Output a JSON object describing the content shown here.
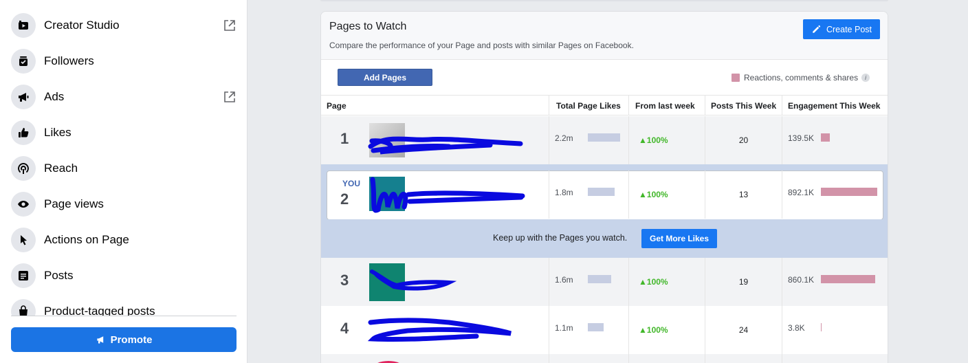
{
  "sidebar": {
    "items": [
      {
        "label": "Creator Studio",
        "icon": "creator-studio-icon",
        "external": true
      },
      {
        "label": "Followers",
        "icon": "followers-icon",
        "external": false
      },
      {
        "label": "Ads",
        "icon": "megaphone-icon",
        "external": true
      },
      {
        "label": "Likes",
        "icon": "thumbs-up-icon",
        "external": false
      },
      {
        "label": "Reach",
        "icon": "reach-icon",
        "external": false
      },
      {
        "label": "Page views",
        "icon": "eye-icon",
        "external": false
      },
      {
        "label": "Actions on Page",
        "icon": "cursor-icon",
        "external": false
      },
      {
        "label": "Posts",
        "icon": "posts-icon",
        "external": false
      },
      {
        "label": "Product-tagged posts",
        "icon": "shopping-bag-icon",
        "external": false
      }
    ],
    "promote_label": "Promote"
  },
  "panel": {
    "title": "Pages to Watch",
    "subtitle": "Compare the performance of your Page and posts with similar Pages on Facebook.",
    "create_post_label": "Create Post",
    "add_pages_label": "Add Pages",
    "legend_label": "Reactions, comments & shares",
    "legend_color": "#d293a8",
    "likes_bar_color": "#c6cde2",
    "columns": {
      "page": "Page",
      "total_likes": "Total Page Likes",
      "from_last_week": "From last week",
      "posts_week": "Posts This Week",
      "engagement_week": "Engagement This Week"
    },
    "rows": [
      {
        "rank": "1",
        "you": "",
        "likes": "2.2m",
        "likes_ratio": 0.92,
        "delta": "100%",
        "posts": "20",
        "engagement": "139.5K",
        "engagement_ratio": 0.16,
        "thumb_color": "#c8c8c8",
        "scribble_color": "#0a0adf"
      },
      {
        "rank": "2",
        "you": "YOU",
        "likes": "1.8m",
        "likes_ratio": 0.76,
        "delta": "100%",
        "posts": "13",
        "engagement": "892.1K",
        "engagement_ratio": 1.0,
        "thumb_color": "#15808f",
        "scribble_color": "#0a0adf"
      },
      {
        "rank": "3",
        "you": "",
        "likes": "1.6m",
        "likes_ratio": 0.67,
        "delta": "100%",
        "posts": "19",
        "engagement": "860.1K",
        "engagement_ratio": 0.96,
        "thumb_color": "#0f8470",
        "scribble_color": "#0a0adf"
      },
      {
        "rank": "4",
        "you": "",
        "likes": "1.1m",
        "likes_ratio": 0.46,
        "delta": "100%",
        "posts": "24",
        "engagement": "3.8K",
        "engagement_ratio": 0.005,
        "thumb_color": "#ffffff",
        "scribble_color": "#0a0adf"
      }
    ],
    "banner_text": "Keep up with the Pages you watch.",
    "get_more_likes_label": "Get More Likes"
  }
}
